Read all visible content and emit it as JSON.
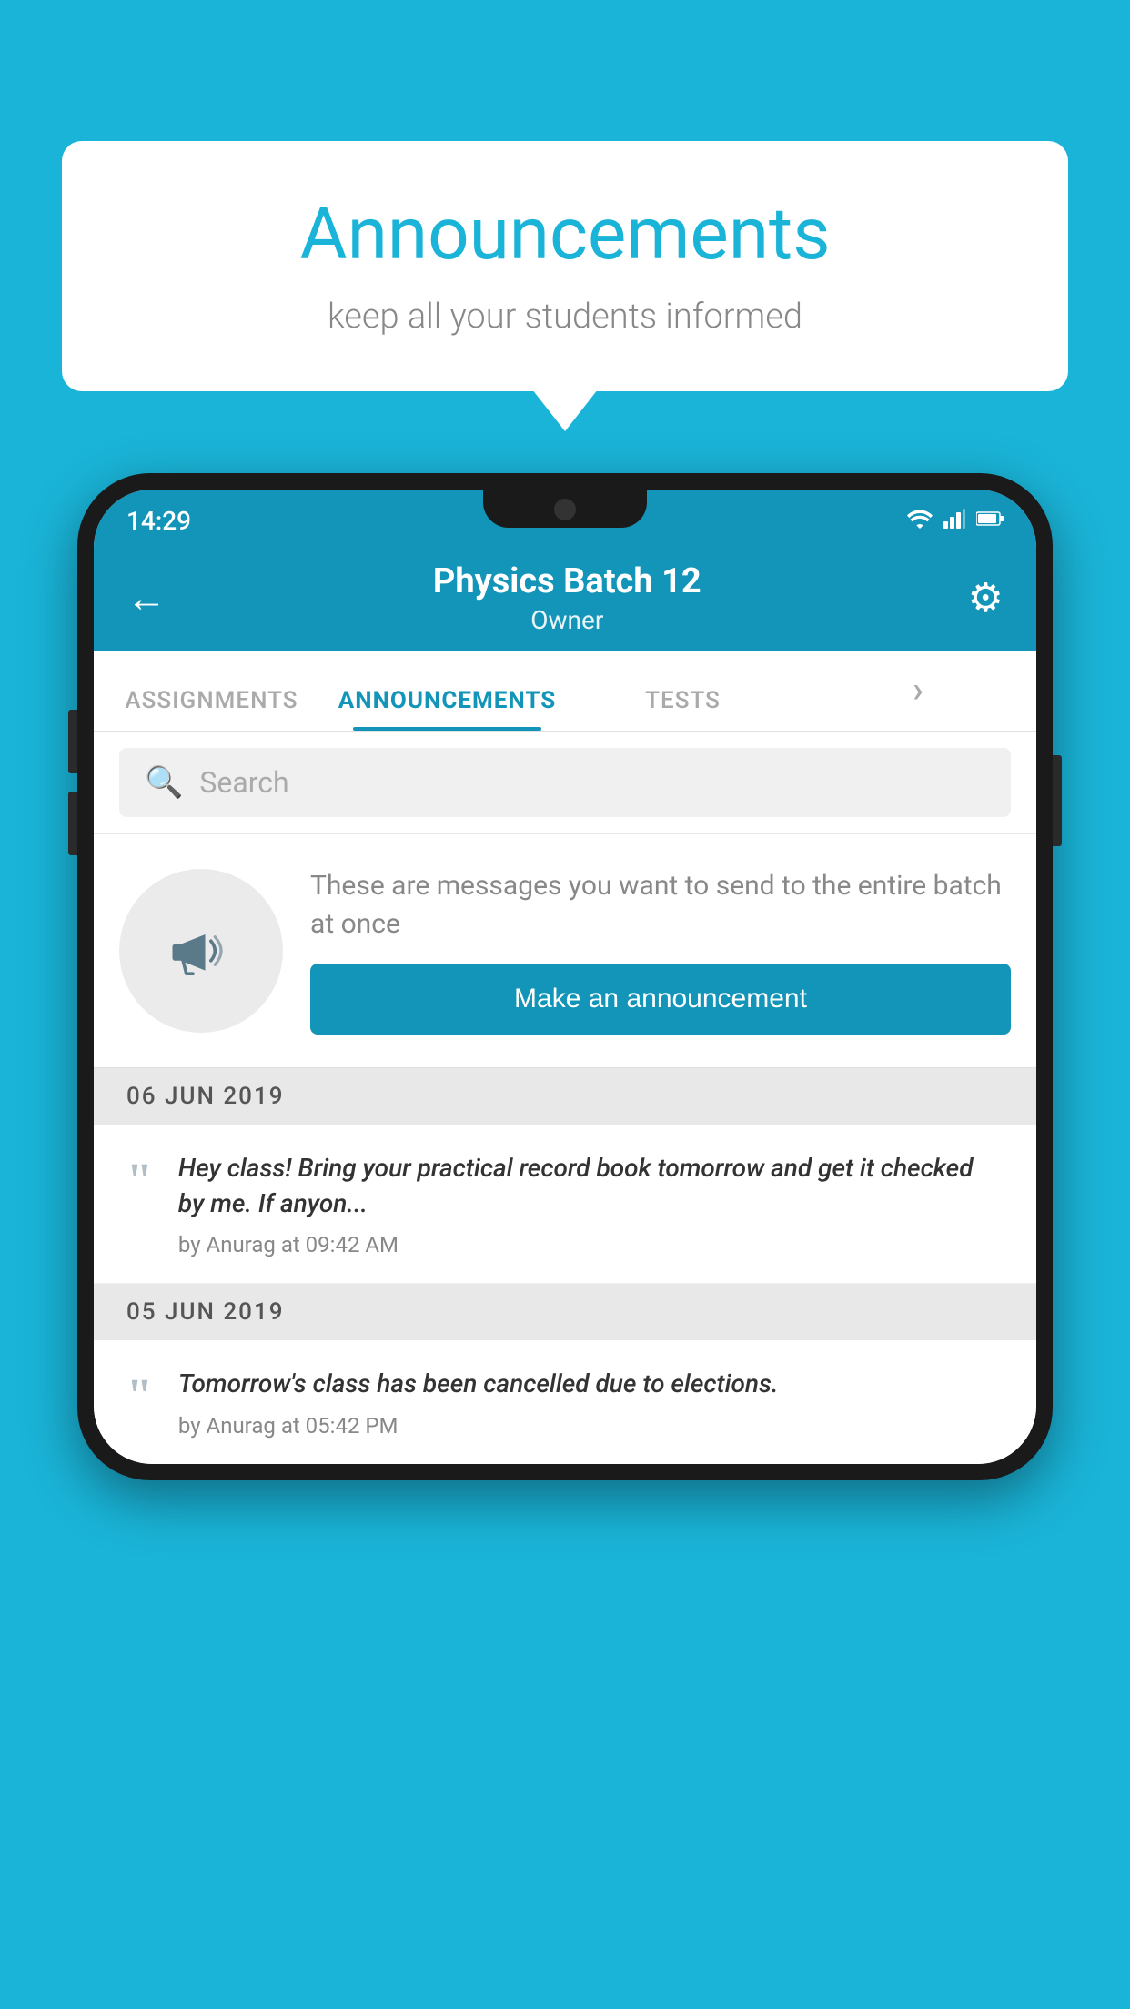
{
  "header": {
    "background_color": "#1ab4d8"
  },
  "speech_bubble": {
    "title": "Announcements",
    "subtitle": "keep all your students informed"
  },
  "phone": {
    "status_bar": {
      "time": "14:29",
      "wifi": "▾",
      "signal": "▾",
      "battery": "▾"
    },
    "toolbar": {
      "back_label": "←",
      "title": "Physics Batch 12",
      "subtitle": "Owner",
      "gear_label": "⚙"
    },
    "tabs": [
      {
        "label": "ASSIGNMENTS",
        "active": false
      },
      {
        "label": "ANNOUNCEMENTS",
        "active": true
      },
      {
        "label": "TESTS",
        "active": false
      },
      {
        "label": "·",
        "active": false
      }
    ],
    "search": {
      "placeholder": "Search"
    },
    "promo": {
      "description": "These are messages you want to send to the entire batch at once",
      "button_label": "Make an announcement"
    },
    "announcements": [
      {
        "date": "06  JUN  2019",
        "text": "Hey class! Bring your practical record book tomorrow and get it checked by me. If anyon...",
        "meta": "by Anurag at 09:42 AM"
      },
      {
        "date": "05  JUN  2019",
        "text": "Tomorrow's class has been cancelled due to elections.",
        "meta": "by Anurag at 05:42 PM"
      }
    ]
  }
}
